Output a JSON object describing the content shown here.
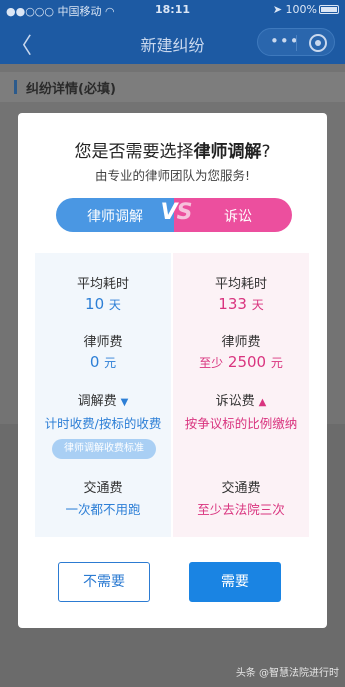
{
  "status_bar": {
    "carrier": "中国移动",
    "time": "18:11",
    "battery": "100%"
  },
  "navbar": {
    "back_icon": "back-chevron-icon",
    "title": "新建纠纷",
    "more_icon": "more-dots-icon",
    "close_icon": "target-close-icon"
  },
  "background_section": {
    "title": "纠纷详情(必填)"
  },
  "modal": {
    "title_prefix": "您是否需要选择",
    "title_bold": "律师调解",
    "title_suffix": "?",
    "subtitle": "由专业的律师团队为您服务!",
    "left_option": "律师调解",
    "vs_v": "V",
    "vs_s": "S",
    "right_option": "诉讼",
    "left": {
      "time_label": "平均耗时",
      "time_value": "10",
      "time_unit": "天",
      "fee_label": "律师费",
      "fee_value": "0",
      "fee_unit": "元",
      "extra_label": "调解费",
      "extra_value": "计时收费/按标的收费",
      "standard_link": "律师调解收费标准",
      "transport_label": "交通费",
      "transport_value": "一次都不用跑"
    },
    "right": {
      "time_label": "平均耗时",
      "time_value": "133",
      "time_unit": "天",
      "fee_label": "律师费",
      "fee_prefix": "至少",
      "fee_value": "2500",
      "fee_unit": "元",
      "extra_label": "诉讼费",
      "extra_value": "按争议标的比例缴纳",
      "transport_label": "交通费",
      "transport_value": "至少去法院三次"
    },
    "cancel_label": "不需要",
    "confirm_label": "需要"
  },
  "watermark": "头条 @智慧法院进行时",
  "colors": {
    "brand_blue": "#1d5aa3",
    "accent_blue": "#2d7fd6",
    "accent_pink": "#d9347f"
  }
}
